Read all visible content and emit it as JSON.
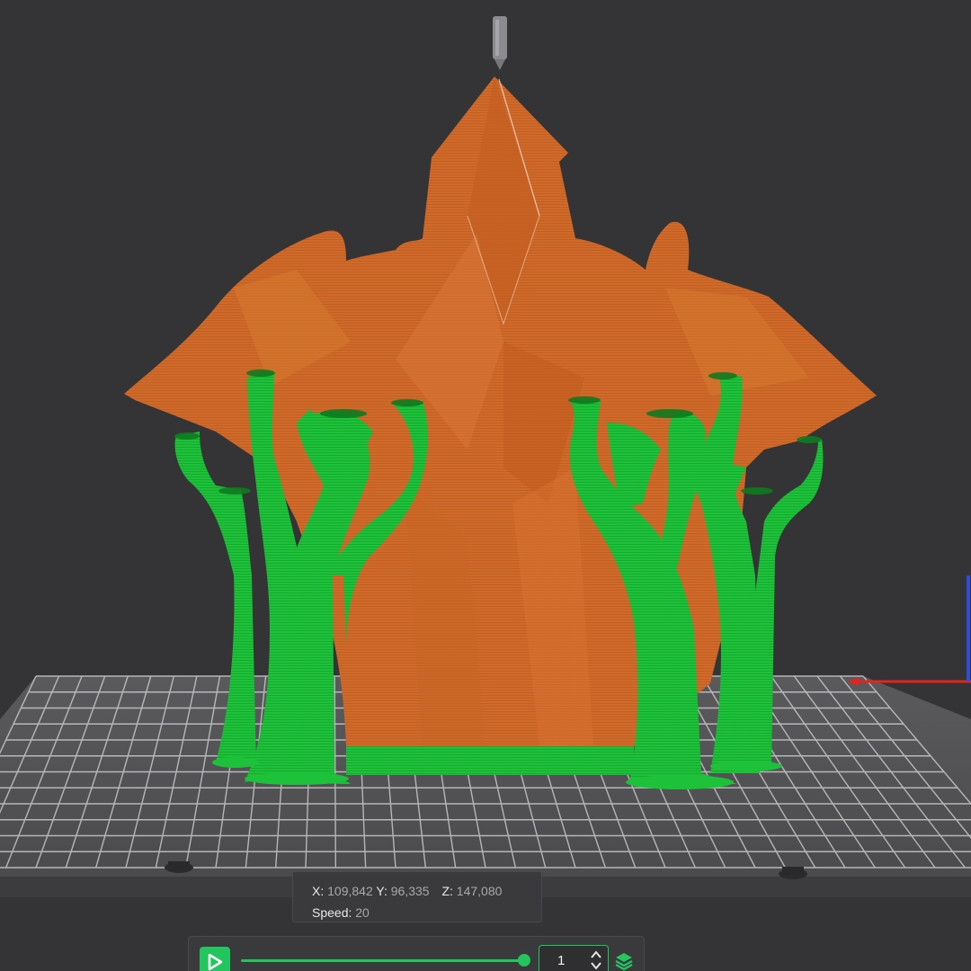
{
  "viewport": {
    "background": "#343436",
    "model_color": "#cf6a2a",
    "support_color": "#1ec23a",
    "bed_color": "#555558",
    "grid_color": "#c9c9cc"
  },
  "gcode_info": {
    "x_label": "X:",
    "x_value": "109,842",
    "y_label": "Y:",
    "y_value": "96,335",
    "z_label": "Z:",
    "z_value": "147,080",
    "speed_label": "Speed:",
    "speed_value": "20"
  },
  "playback": {
    "play_icon": "play-icon",
    "progress": 1.0,
    "layer_value": "1",
    "accent": "#22c55e",
    "layers_icon": "layers-icon"
  },
  "axes": {
    "x_axis_color": "#e0261f",
    "z_axis_color": "#2b4ee0"
  }
}
